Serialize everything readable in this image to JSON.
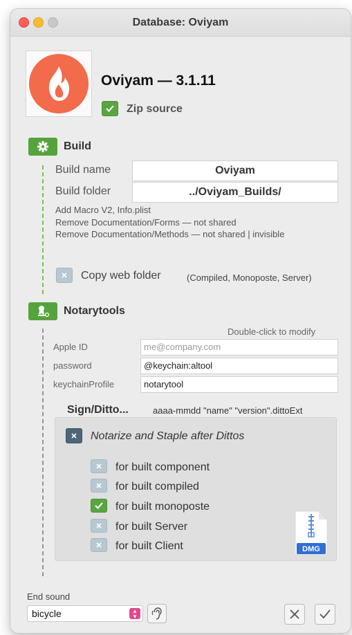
{
  "window": {
    "title": "Database: Oviyam"
  },
  "app": {
    "icon": "flame-logo-icon",
    "accent": "#f26b4a",
    "title": "Oviyam — 3.1.11"
  },
  "zip_source": {
    "label": "Zip source",
    "checked": true
  },
  "build": {
    "title": "Build",
    "icon": "gear-icon",
    "name_label": "Build name",
    "name_value": "Oviyam",
    "folder_label": "Build folder",
    "folder_value": "../Oviyam_Builds/",
    "notes": [
      "Add Macro V2, Info.plist",
      "Remove Documentation/Forms — not shared",
      "Remove Documentation/Methods — not shared | invisible"
    ],
    "copy_web_folder": {
      "label": "Copy web folder",
      "checked": false,
      "hint": "(Compiled, Monoposte, Server)"
    }
  },
  "notarytools": {
    "title": "Notarytools",
    "icon": "certificate-icon",
    "hint": "Double-click to modify",
    "apple_id_label": "Apple ID",
    "apple_id_placeholder": "me@company.com",
    "password_label": "password",
    "password_value": "@keychain:altool",
    "keychain_label": "keychainProfile",
    "keychain_value": "notarytool",
    "sign_title": "Sign/Ditto...",
    "sign_pattern": "aaaa-mmdd \"name\" \"version\".dittoExt",
    "notarize_label": "Notarize and Staple after Dittos",
    "notarize_checked": false,
    "options": [
      {
        "label": "for built component",
        "checked": false
      },
      {
        "label": "for built compiled",
        "checked": false
      },
      {
        "label": "for built monoposte",
        "checked": true
      },
      {
        "label": "for built Server",
        "checked": false
      },
      {
        "label": "for built Client",
        "checked": false
      }
    ],
    "dmg_label": "DMG"
  },
  "footer": {
    "end_sound_label": "End sound",
    "end_sound_value": "bicycle"
  },
  "colors": {
    "green": "#55a33d",
    "check_off": "#b8c8d2",
    "dmg_blue": "#2f6fd6"
  }
}
